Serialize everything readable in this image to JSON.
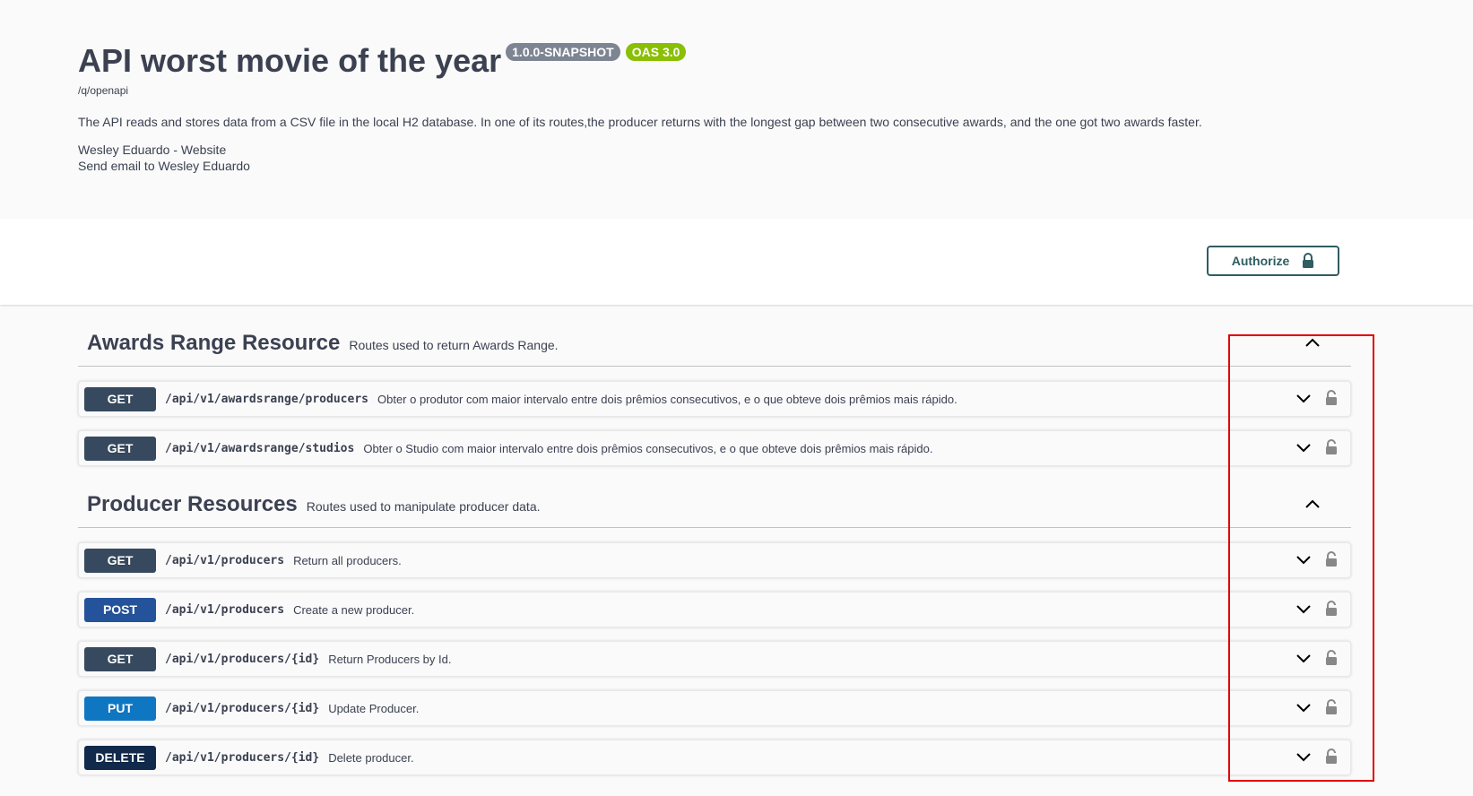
{
  "info": {
    "title": "API worst movie of the year",
    "version_badge": "1.0.0-SNAPSHOT",
    "oas_badge": "OAS 3.0",
    "url": "/q/openapi",
    "description": "The API reads and stores data from a CSV file in the local H2 database. In one of its routes,the producer returns with the longest gap between two consecutive awards, and the one got two awards faster.",
    "contact_website": "Wesley Eduardo - Website",
    "contact_email": "Send email to Wesley Eduardo"
  },
  "authorize": {
    "label": "Authorize",
    "icon": "lock-icon"
  },
  "sections": [
    {
      "title": "Awards Range Resource",
      "description": "Routes used to return Awards Range.",
      "operations": [
        {
          "method": "GET",
          "path": "/api/v1/awardsrange/producers",
          "summary": "Obter o produtor com maior intervalo entre dois prêmios consecutivos, e o que obteve dois prêmios mais rápido."
        },
        {
          "method": "GET",
          "path": "/api/v1/awardsrange/studios",
          "summary": "Obter o Studio com maior intervalo entre dois prêmios consecutivos, e o que obteve dois prêmios mais rápido."
        }
      ]
    },
    {
      "title": "Producer Resources",
      "description": "Routes used to manipulate producer data.",
      "operations": [
        {
          "method": "GET",
          "path": "/api/v1/producers",
          "summary": "Return all producers."
        },
        {
          "method": "POST",
          "path": "/api/v1/producers",
          "summary": "Create a new producer."
        },
        {
          "method": "GET",
          "path": "/api/v1/producers/{id}",
          "summary": "Return Producers by Id."
        },
        {
          "method": "PUT",
          "path": "/api/v1/producers/{id}",
          "summary": "Update Producer."
        },
        {
          "method": "DELETE",
          "path": "/api/v1/producers/{id}",
          "summary": "Delete producer."
        }
      ]
    }
  ],
  "colors": {
    "get": "#36495e",
    "post": "#24539b",
    "put": "#0f76c2",
    "delete": "#11294a",
    "highlight": "#e00000"
  }
}
